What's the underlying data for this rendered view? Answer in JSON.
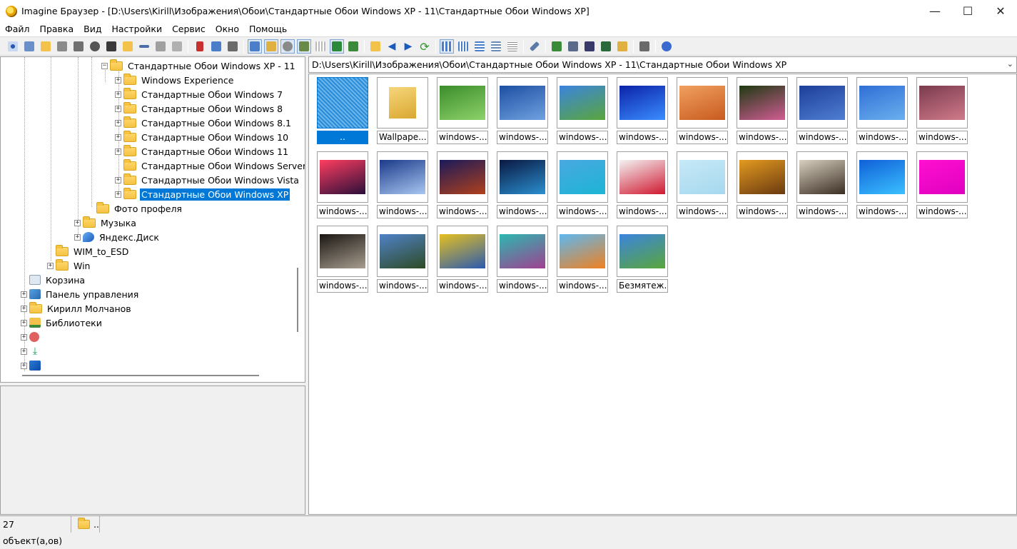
{
  "window": {
    "title": "Imagine Браузер - [D:\\Users\\Kirill\\Изображения\\Обои\\Стандартные Обои Windows  XP - 11\\Стандартные Обои Windows XP]"
  },
  "menu": [
    "Файл",
    "Правка",
    "Вид",
    "Настройки",
    "Сервис",
    "Окно",
    "Помощь"
  ],
  "tree": {
    "root_parent": "Стандартные Обои Windows  XP - 11",
    "children": [
      "Windows Experience",
      "Стандартные Обои Windows 7",
      "Стандартные Обои Windows 8",
      "Стандартные Обои Windows 8.1",
      "Стандартные Обои Windows 10",
      "Стандартные Обои Windows 11",
      "Стандартные Обои Windows Server",
      "Стандартные Обои Windows Vista",
      "Стандартные Обои Windows XP"
    ],
    "profile_photo": "Фото профеля",
    "music": "Музыка",
    "yandex": "Яндекс.Диск",
    "wim": "WIM_to_ESD",
    "win": "Win",
    "recycle": "Корзина",
    "control_panel": "Панель управления",
    "user": "Кирилл Молчанов",
    "libraries": "Библиотеки"
  },
  "address": "D:\\Users\\Kirill\\Изображения\\Обои\\Стандартные Обои Windows  XP - 11\\Стандартные Обои Windows XP",
  "thumbnails": [
    {
      "caption": "..",
      "colors": [
        "#3b8fd8",
        "#3b8fd8"
      ]
    },
    {
      "caption": "Wallpape...",
      "colors": [
        "#f6d67b",
        "#d9a730"
      ]
    },
    {
      "caption": "windows-...",
      "colors": [
        "#3a8d2b",
        "#8ed26a"
      ]
    },
    {
      "caption": "windows-...",
      "colors": [
        "#1d4fa3",
        "#6fa1e0"
      ]
    },
    {
      "caption": "windows-...",
      "colors": [
        "#3b84de",
        "#5aa63a"
      ]
    },
    {
      "caption": "windows-...",
      "colors": [
        "#0b22a8",
        "#3a8dff"
      ]
    },
    {
      "caption": "windows-...",
      "colors": [
        "#f0a060",
        "#c85a1e"
      ]
    },
    {
      "caption": "windows-...",
      "colors": [
        "#1e3a12",
        "#d25c94"
      ]
    },
    {
      "caption": "windows-...",
      "colors": [
        "#1d3f9a",
        "#4f7ed2"
      ]
    },
    {
      "caption": "windows-...",
      "colors": [
        "#2f6fd6",
        "#6ab0ee"
      ]
    },
    {
      "caption": "windows-...",
      "colors": [
        "#7a3b4e",
        "#d07a8a"
      ]
    },
    {
      "caption": "windows-...",
      "colors": [
        "#ff3d60",
        "#2b0f3a"
      ]
    },
    {
      "caption": "windows-...",
      "colors": [
        "#1b3a8a",
        "#a8c6f0"
      ]
    },
    {
      "caption": "windows-...",
      "colors": [
        "#1a1a5a",
        "#b0401c"
      ]
    },
    {
      "caption": "windows-...",
      "colors": [
        "#0a1840",
        "#2a8fd0"
      ]
    },
    {
      "caption": "windows-...",
      "colors": [
        "#49a8e0",
        "#1db5d6"
      ]
    },
    {
      "caption": "windows-...",
      "colors": [
        "#f3f3f3",
        "#d01830"
      ]
    },
    {
      "caption": "windows-...",
      "colors": [
        "#c6e9f7",
        "#a6d8ee"
      ]
    },
    {
      "caption": "windows-...",
      "colors": [
        "#e39a20",
        "#6a3a10"
      ]
    },
    {
      "caption": "windows-...",
      "colors": [
        "#d8cfc0",
        "#3a2e22"
      ]
    },
    {
      "caption": "windows-...",
      "colors": [
        "#1060d8",
        "#3ac0ff"
      ]
    },
    {
      "caption": "windows-...",
      "colors": [
        "#ff10d0",
        "#e000c0"
      ]
    },
    {
      "caption": "windows-...",
      "colors": [
        "#1a1612",
        "#a89e90"
      ]
    },
    {
      "caption": "windows-...",
      "colors": [
        "#4f82c8",
        "#2e4a24"
      ]
    },
    {
      "caption": "windows-...",
      "colors": [
        "#e6c020",
        "#2a5ab0"
      ]
    },
    {
      "caption": "windows-...",
      "colors": [
        "#2cb8b0",
        "#a04090"
      ]
    },
    {
      "caption": "windows-...",
      "colors": [
        "#5db8f0",
        "#f08020"
      ]
    },
    {
      "caption": "Безмятеж...",
      "colors": [
        "#3b84de",
        "#5aa63a"
      ]
    }
  ],
  "status": {
    "count": "27 объект(а,ов)",
    "path": ".."
  }
}
